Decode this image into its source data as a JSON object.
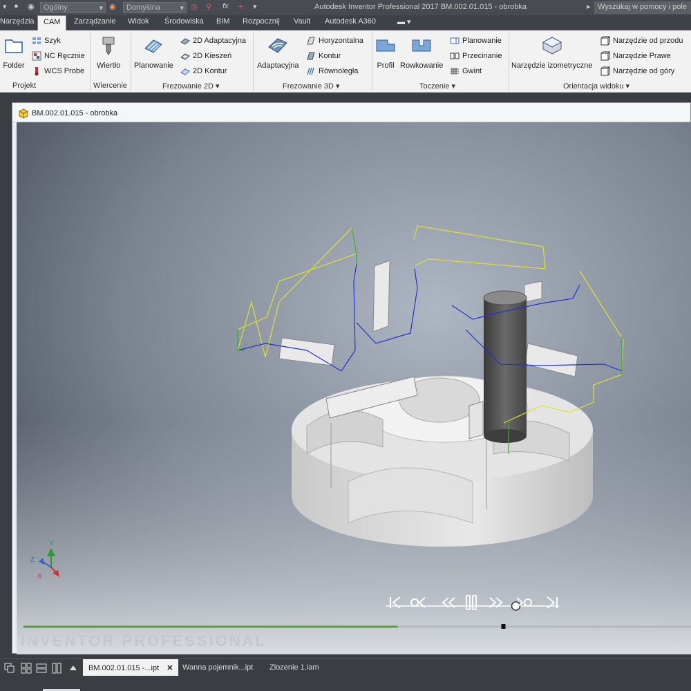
{
  "titlebar": {
    "style_dropdown": "Ogólny",
    "material_dropdown": "Domyślna",
    "fx_label": "fx",
    "app_title": "Autodesk Inventor Professional 2017   BM.002.01.015 - obrobka",
    "help_search_placeholder": "Wyszukaj w pomocy i pole"
  },
  "tabs": [
    {
      "label": "Narzędzia"
    },
    {
      "label": "CAM"
    },
    {
      "label": "Zarządzanie"
    },
    {
      "label": "Widok"
    },
    {
      "label": "Środowiska"
    },
    {
      "label": "BIM"
    },
    {
      "label": "Rozpocznij"
    },
    {
      "label": "Vault"
    },
    {
      "label": "Autodesk A360"
    }
  ],
  "ribbon": {
    "projekt": {
      "title": "Projekt",
      "folder": "Folder",
      "szyk": "Szyk",
      "nc_recznie": "NC Ręcznie",
      "wcs_probe": "WCS Probe"
    },
    "wiercenie": {
      "title": "Wiercenie",
      "wiertlo": "Wiertło"
    },
    "frezowanie2d": {
      "title": "Frezowanie 2D",
      "planowanie": "Planowanie",
      "adaptacyjna": "2D Adaptacyjna",
      "kieszen": "2D Kieszeń",
      "kontur": "2D Kontur"
    },
    "frezowanie3d": {
      "title": "Frezowanie 3D",
      "adaptacyjna": "Adaptacyjna",
      "horyzontalna": "Horyzontalna",
      "kontur": "Kontur",
      "rownolegla": "Równoległa"
    },
    "toczenie": {
      "title": "Toczenie",
      "profil": "Profil",
      "rowkowanie": "Rowkowanie",
      "planowanie": "Planowanie",
      "przecinanie": "Przecinanie",
      "gwint": "Gwint"
    },
    "orientacja": {
      "title": "Orientacja widoku",
      "izometryczne": "Narzędzie izometryczne",
      "od_przodu": "Narzędzie od przodu",
      "prawe": "Narzędzie Prawe",
      "od_gory": "Narzędzie od góry"
    }
  },
  "document": {
    "title": "BM.002.01.015 - obrobka",
    "watermark": "INVENTOR  PROFESSIONAL",
    "axes": {
      "x": "X",
      "y": "Y",
      "z": "Z"
    },
    "playback": {
      "speed_position": 0.75,
      "timeline_progress": 0.56
    }
  },
  "bottom_tabs": [
    {
      "label": "BM.002.01.015 -...ipt"
    },
    {
      "label": "Wanna pojemnik...ipt"
    },
    {
      "label": "Zlozenie 1.iam"
    }
  ],
  "colors": {
    "toolpath_feed": "#2233cc",
    "toolpath_rapid": "#e0e030",
    "toolpath_plunge": "#33aa33",
    "timeline_done": "#5a9a3a",
    "accent": "#3c7fc4"
  }
}
